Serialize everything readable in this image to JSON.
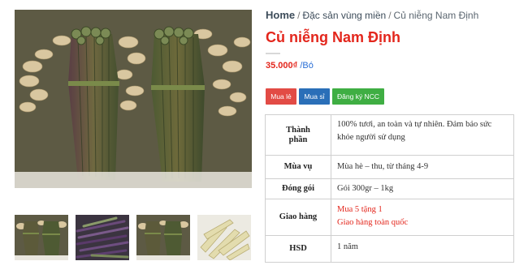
{
  "breadcrumb": {
    "home": "Home",
    "category": "Đặc sản vùng miền",
    "current": "Củ niễng Nam Định",
    "separator": "/"
  },
  "product": {
    "title": "Củ niễng Nam Định",
    "price": "35.000₫",
    "unit": "/Bó"
  },
  "buttons": {
    "retail": "Mua lẻ",
    "wholesale": "Mua sỉ",
    "register": "Đăng ký NCC"
  },
  "specs": [
    {
      "label_lines": [
        "Thành",
        "phần"
      ],
      "value_lines": [
        "100% tươi, an toàn và tự nhiên. Đảm bảo sức",
        "khỏe người sử dụng"
      ]
    },
    {
      "label_lines": [
        "Mùa vụ"
      ],
      "value_lines": [
        "Mùa hè – thu, từ tháng 4-9"
      ]
    },
    {
      "label_lines": [
        "Đóng gói"
      ],
      "value_lines": [
        "Gói  300gr – 1kg"
      ]
    },
    {
      "label_lines": [
        "Giao hàng"
      ],
      "value_lines": [
        "Mua 5 tặng 1",
        "Giao hàng toàn quốc"
      ]
    },
    {
      "label_lines": [
        "HSD"
      ],
      "value_lines": [
        "1 năm"
      ]
    }
  ],
  "colors": {
    "accent_red": "#e3261c",
    "price_unit_blue": "#2a6fd6",
    "btn_retail": "#e24b45",
    "btn_wholesale": "#2a6fb8",
    "btn_register": "#3fae43"
  },
  "gallery": {
    "main_image": "cu-nieng-bundles-photo",
    "thumbnails": [
      "cu-nieng-bundles-photo",
      "cu-nieng-purple-photo",
      "cu-nieng-bundles-photo",
      "cu-nieng-peeled-photo"
    ]
  }
}
